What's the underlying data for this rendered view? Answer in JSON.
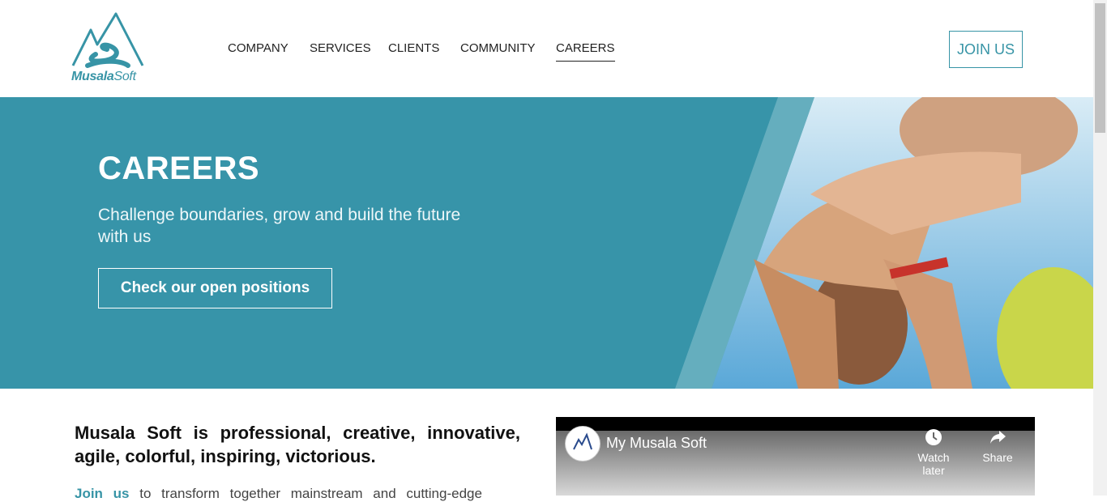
{
  "brand": {
    "name_bold": "Musala",
    "name_rest": "Soft",
    "color": "#3794a6"
  },
  "nav": {
    "items": [
      {
        "label": "COMPANY"
      },
      {
        "label": "SERVICES"
      },
      {
        "label": "CLIENTS"
      },
      {
        "label": "COMMUNITY"
      },
      {
        "label": "CAREERS",
        "active": true
      }
    ]
  },
  "header": {
    "join_label": "JOIN US"
  },
  "hero": {
    "title": "CAREERS",
    "subtitle": "Challenge boundaries, grow and build the future with us",
    "cta_label": "Check our open positions",
    "background_color": "#3794a9"
  },
  "intro": {
    "heading": "Musala Soft is professional, creative, innovative, agile, colorful, inspiring, victorious.",
    "link_text": "Join us",
    "text": "to transform together mainstream and cutting-edge"
  },
  "video": {
    "title": "My Musala Soft",
    "watch_later_label": "Watch later",
    "share_label": "Share",
    "icons": [
      "clock-icon",
      "share-icon"
    ]
  }
}
